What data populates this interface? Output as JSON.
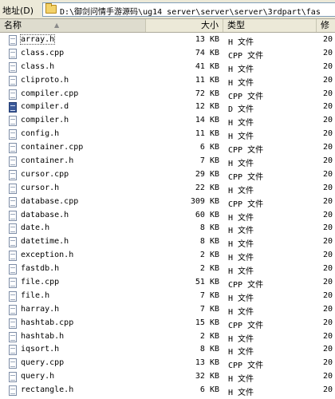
{
  "address_bar": {
    "label": "地址(D)",
    "path": "D:\\御剑问情手游源码\\ug14_server\\server\\server\\3rdpart\\fas"
  },
  "columns": {
    "name": "名称",
    "size": "大小",
    "type": "类型",
    "modified": "修"
  },
  "files": [
    {
      "name": "array.h",
      "size": "13 KB",
      "type": "H 文件",
      "modified": "20",
      "icon": "h-file-icon"
    },
    {
      "name": "class.cpp",
      "size": "74 KB",
      "type": "CPP 文件",
      "modified": "20",
      "icon": "cpp-file-icon"
    },
    {
      "name": "class.h",
      "size": "41 KB",
      "type": "H 文件",
      "modified": "20",
      "icon": "h-file-icon"
    },
    {
      "name": "cliproto.h",
      "size": "11 KB",
      "type": "H 文件",
      "modified": "20",
      "icon": "h-file-icon"
    },
    {
      "name": "compiler.cpp",
      "size": "72 KB",
      "type": "CPP 文件",
      "modified": "20",
      "icon": "cpp-file-icon"
    },
    {
      "name": "compiler.d",
      "size": "12 KB",
      "type": "D 文件",
      "modified": "20",
      "icon": "d-file-icon"
    },
    {
      "name": "compiler.h",
      "size": "14 KB",
      "type": "H 文件",
      "modified": "20",
      "icon": "h-file-icon"
    },
    {
      "name": "config.h",
      "size": "11 KB",
      "type": "H 文件",
      "modified": "20",
      "icon": "h-file-icon"
    },
    {
      "name": "container.cpp",
      "size": "6 KB",
      "type": "CPP 文件",
      "modified": "20",
      "icon": "cpp-file-icon"
    },
    {
      "name": "container.h",
      "size": "7 KB",
      "type": "H 文件",
      "modified": "20",
      "icon": "h-file-icon"
    },
    {
      "name": "cursor.cpp",
      "size": "29 KB",
      "type": "CPP 文件",
      "modified": "20",
      "icon": "cpp-file-icon"
    },
    {
      "name": "cursor.h",
      "size": "22 KB",
      "type": "H 文件",
      "modified": "20",
      "icon": "h-file-icon"
    },
    {
      "name": "database.cpp",
      "size": "309 KB",
      "type": "CPP 文件",
      "modified": "20",
      "icon": "cpp-file-icon"
    },
    {
      "name": "database.h",
      "size": "60 KB",
      "type": "H 文件",
      "modified": "20",
      "icon": "h-file-icon"
    },
    {
      "name": "date.h",
      "size": "8 KB",
      "type": "H 文件",
      "modified": "20",
      "icon": "h-file-icon"
    },
    {
      "name": "datetime.h",
      "size": "8 KB",
      "type": "H 文件",
      "modified": "20",
      "icon": "h-file-icon"
    },
    {
      "name": "exception.h",
      "size": "2 KB",
      "type": "H 文件",
      "modified": "20",
      "icon": "h-file-icon"
    },
    {
      "name": "fastdb.h",
      "size": "2 KB",
      "type": "H 文件",
      "modified": "20",
      "icon": "h-file-icon"
    },
    {
      "name": "file.cpp",
      "size": "51 KB",
      "type": "CPP 文件",
      "modified": "20",
      "icon": "cpp-file-icon"
    },
    {
      "name": "file.h",
      "size": "7 KB",
      "type": "H 文件",
      "modified": "20",
      "icon": "h-file-icon"
    },
    {
      "name": "harray.h",
      "size": "7 KB",
      "type": "H 文件",
      "modified": "20",
      "icon": "h-file-icon"
    },
    {
      "name": "hashtab.cpp",
      "size": "15 KB",
      "type": "CPP 文件",
      "modified": "20",
      "icon": "cpp-file-icon"
    },
    {
      "name": "hashtab.h",
      "size": "2 KB",
      "type": "H 文件",
      "modified": "20",
      "icon": "h-file-icon"
    },
    {
      "name": "iqsort.h",
      "size": "8 KB",
      "type": "H 文件",
      "modified": "20",
      "icon": "h-file-icon"
    },
    {
      "name": "query.cpp",
      "size": "13 KB",
      "type": "CPP 文件",
      "modified": "20",
      "icon": "cpp-file-icon"
    },
    {
      "name": "query.h",
      "size": "32 KB",
      "type": "H 文件",
      "modified": "20",
      "icon": "h-file-icon"
    },
    {
      "name": "rectangle.h",
      "size": "6 KB",
      "type": "H 文件",
      "modified": "20",
      "icon": "h-file-icon"
    }
  ]
}
